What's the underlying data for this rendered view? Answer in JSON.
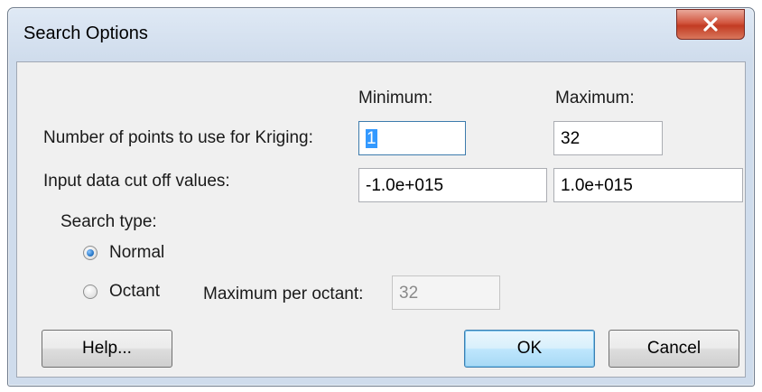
{
  "dialog": {
    "title": "Search Options",
    "close_icon": "close-icon"
  },
  "columns": {
    "minimum_label": "Minimum:",
    "maximum_label": "Maximum:"
  },
  "kriging": {
    "label": "Number of points to use for Kriging:",
    "minimum_value": "1",
    "maximum_value": "32"
  },
  "cutoff": {
    "label": "Input data cut off values:",
    "minimum_value": "-1.0e+015",
    "maximum_value": "1.0e+015"
  },
  "search_type": {
    "label": "Search type:",
    "options": [
      {
        "label": "Normal",
        "selected": true
      },
      {
        "label": "Octant",
        "selected": false
      }
    ],
    "max_per_octant_label": "Maximum per octant:",
    "max_per_octant_value": "32"
  },
  "buttons": {
    "help": "Help...",
    "ok": "OK",
    "cancel": "Cancel"
  },
  "colors": {
    "close_button": "#c7432b",
    "default_button_border": "#3c7fb1",
    "selection": "#3399ff"
  }
}
